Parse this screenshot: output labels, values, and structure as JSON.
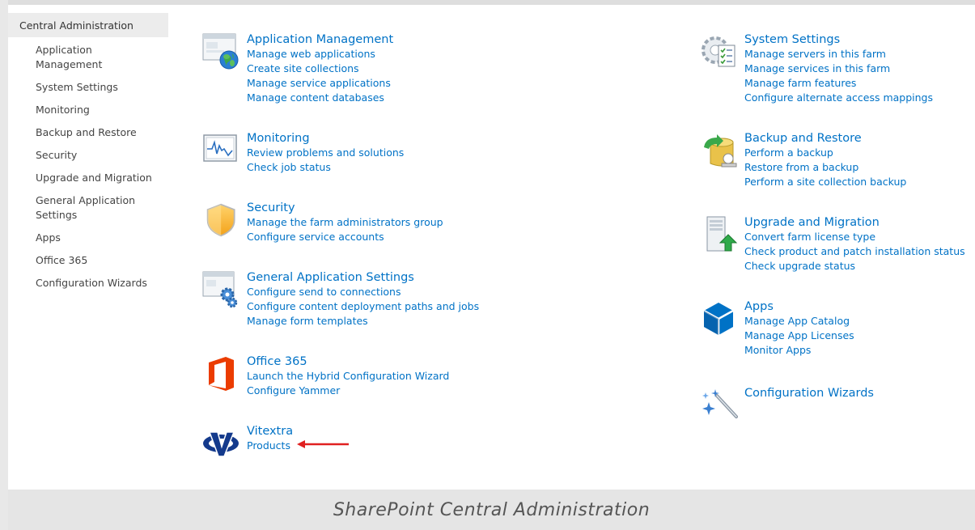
{
  "sidebar": {
    "heading": "Central Administration",
    "items": [
      {
        "label": "Application Management"
      },
      {
        "label": "System Settings"
      },
      {
        "label": "Monitoring"
      },
      {
        "label": "Backup and Restore"
      },
      {
        "label": "Security"
      },
      {
        "label": "Upgrade and Migration"
      },
      {
        "label": "General Application Settings"
      },
      {
        "label": "Apps"
      },
      {
        "label": "Office 365"
      },
      {
        "label": "Configuration Wizards"
      }
    ]
  },
  "sections": {
    "app_mgmt": {
      "title": "Application Management",
      "icon": "web-application-globe-icon",
      "links": [
        "Manage web applications",
        "Create site collections",
        "Manage service applications",
        "Manage content databases"
      ]
    },
    "monitoring": {
      "title": "Monitoring",
      "icon": "monitor-waveform-icon",
      "links": [
        "Review problems and solutions",
        "Check job status"
      ]
    },
    "security": {
      "title": "Security",
      "icon": "shield-icon",
      "links": [
        "Manage the farm administrators group",
        "Configure service accounts"
      ]
    },
    "general": {
      "title": "General Application Settings",
      "icon": "settings-gear-window-icon",
      "links": [
        "Configure send to connections",
        "Configure content deployment paths and jobs",
        "Manage form templates"
      ]
    },
    "office365": {
      "title": "Office 365",
      "icon": "office-logo-icon",
      "links": [
        "Launch the Hybrid Configuration Wizard",
        "Configure Yammer"
      ]
    },
    "vitextra": {
      "title": "Vitextra",
      "icon": "vitextra-logo-icon",
      "links": [
        "Products"
      ]
    },
    "system": {
      "title": "System Settings",
      "icon": "gear-checklist-icon",
      "links": [
        "Manage servers in this farm",
        "Manage services in this farm",
        "Manage farm features",
        "Configure alternate access mappings"
      ]
    },
    "backup": {
      "title": "Backup and Restore",
      "icon": "database-sync-icon",
      "links": [
        "Perform a backup",
        "Restore from a backup",
        "Perform a site collection backup"
      ]
    },
    "upgrade": {
      "title": "Upgrade and Migration",
      "icon": "server-upgrade-icon",
      "links": [
        "Convert farm license type",
        "Check product and patch installation status",
        "Check upgrade status"
      ]
    },
    "apps": {
      "title": "Apps",
      "icon": "app-cube-icon",
      "links": [
        "Manage App Catalog",
        "Manage App Licenses",
        "Monitor Apps"
      ]
    },
    "wizards": {
      "title": "Configuration Wizards",
      "icon": "magic-wand-icon",
      "links": []
    }
  },
  "caption": "SharePoint Central Administration",
  "colors": {
    "link": "#0072c6",
    "annotation_arrow": "#e02020",
    "office_orange": "#eb3c00",
    "apps_blue": "#0072c6"
  }
}
